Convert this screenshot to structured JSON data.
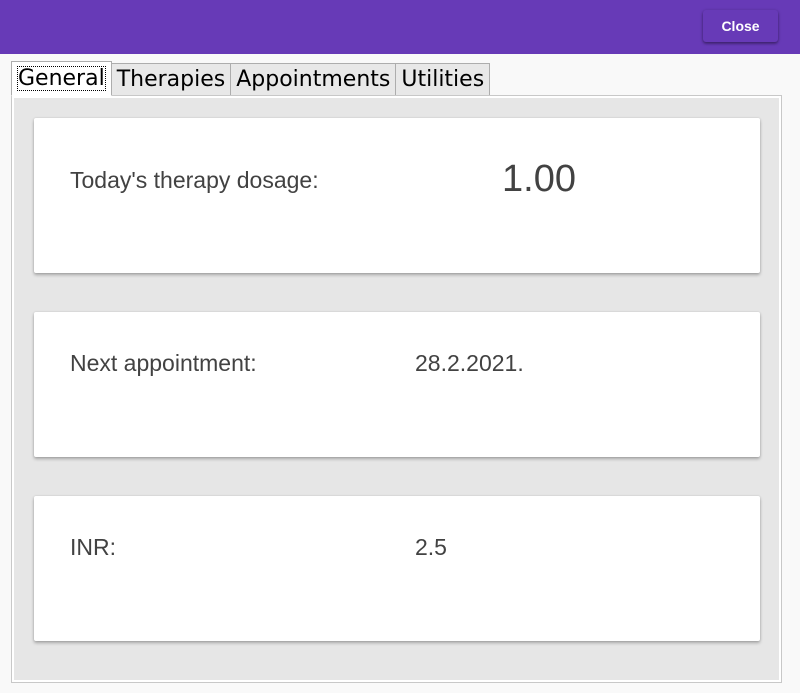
{
  "header": {
    "close_label": "Close",
    "accent_color": "#673ab7"
  },
  "tabs": [
    {
      "label": "General",
      "active": true
    },
    {
      "label": "Therapies",
      "active": false
    },
    {
      "label": "Appointments",
      "active": false
    },
    {
      "label": "Utilities",
      "active": false
    }
  ],
  "general": {
    "dosage": {
      "label": "Today's therapy dosage:",
      "value": "1.00"
    },
    "appointment": {
      "label": "Next appointment:",
      "value": "28.2.2021."
    },
    "inr": {
      "label": "INR:",
      "value": "2.5"
    }
  }
}
